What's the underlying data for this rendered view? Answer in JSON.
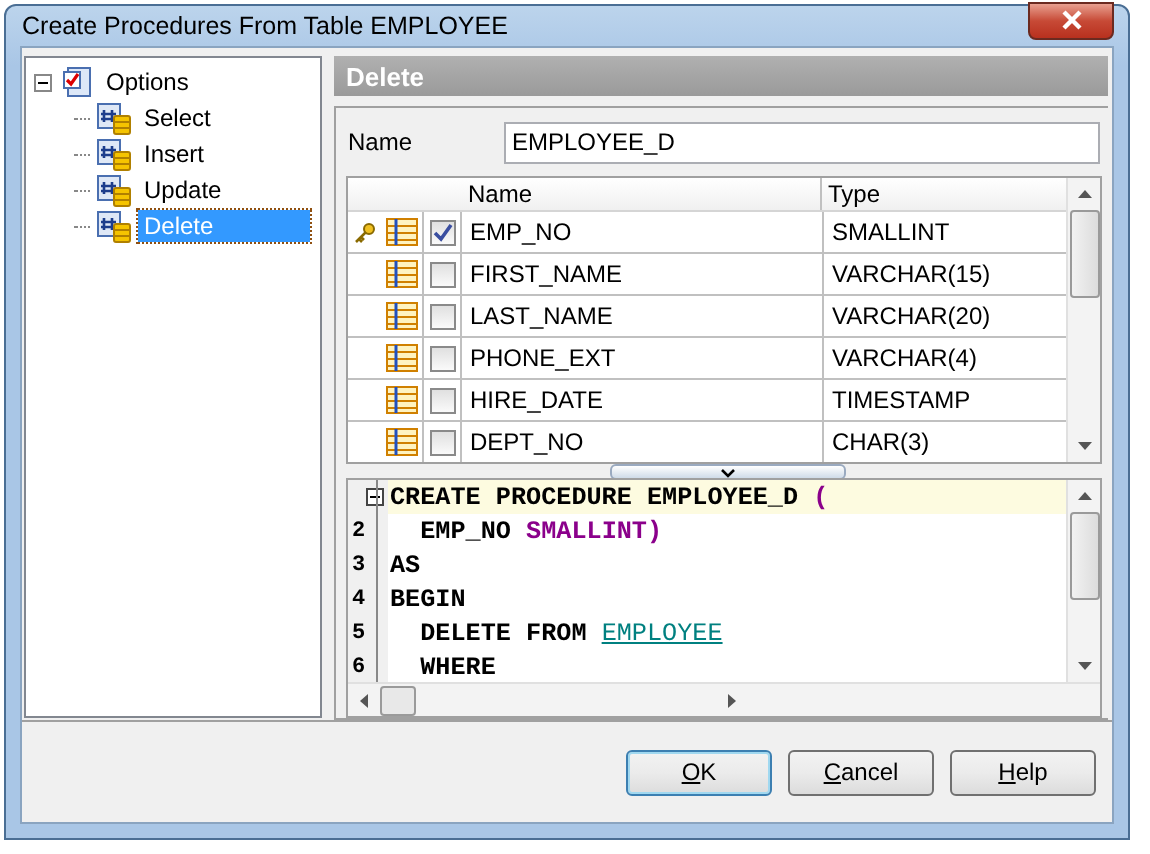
{
  "window": {
    "title": "Create Procedures From Table EMPLOYEE"
  },
  "tree": {
    "label": "Options",
    "expanded": true,
    "selected": false,
    "children": [
      {
        "label": "Select",
        "selected": false
      },
      {
        "label": "Insert",
        "selected": false
      },
      {
        "label": "Update",
        "selected": false
      },
      {
        "label": "Delete",
        "selected": true
      }
    ]
  },
  "panel_title": "Delete",
  "name_field": {
    "label": "Name",
    "value": "EMPLOYEE_D"
  },
  "grid": {
    "columns": [
      "Name",
      "Type"
    ],
    "rows": [
      {
        "key": true,
        "checked": true,
        "name": "EMP_NO",
        "type": "SMALLINT"
      },
      {
        "key": false,
        "checked": false,
        "name": "FIRST_NAME",
        "type": "VARCHAR(15)"
      },
      {
        "key": false,
        "checked": false,
        "name": "LAST_NAME",
        "type": "VARCHAR(20)"
      },
      {
        "key": false,
        "checked": false,
        "name": "PHONE_EXT",
        "type": "VARCHAR(4)"
      },
      {
        "key": false,
        "checked": false,
        "name": "HIRE_DATE",
        "type": "TIMESTAMP"
      },
      {
        "key": false,
        "checked": false,
        "name": "DEPT_NO",
        "type": "CHAR(3)"
      }
    ]
  },
  "editor": {
    "lines": [
      {
        "fold": true,
        "current": true,
        "tokens": [
          {
            "text": "CREATE PROCEDURE EMPLOYEE_D ",
            "kind": "keyword"
          },
          {
            "text": "(",
            "kind": "type"
          }
        ]
      },
      {
        "number": "2",
        "current": false,
        "tokens": [
          {
            "text": "  EMP_NO ",
            "kind": "keyword"
          },
          {
            "text": "SMALLINT)",
            "kind": "type"
          }
        ]
      },
      {
        "number": "3",
        "current": false,
        "tokens": [
          {
            "text": "AS",
            "kind": "keyword"
          }
        ]
      },
      {
        "number": "4",
        "current": false,
        "tokens": [
          {
            "text": "BEGIN",
            "kind": "keyword"
          }
        ]
      },
      {
        "number": "5",
        "current": false,
        "tokens": [
          {
            "text": "  DELETE FROM ",
            "kind": "keyword"
          },
          {
            "text": "EMPLOYEE",
            "kind": "link"
          }
        ]
      },
      {
        "number": "6",
        "current": false,
        "tokens": [
          {
            "text": "  WHERE",
            "kind": "keyword"
          }
        ]
      }
    ]
  },
  "buttons": [
    {
      "mnemonic": "O",
      "rest": "K",
      "default": true
    },
    {
      "mnemonic": "C",
      "rest": "ancel",
      "default": false
    },
    {
      "mnemonic": "H",
      "rest": "elp",
      "default": false
    }
  ]
}
